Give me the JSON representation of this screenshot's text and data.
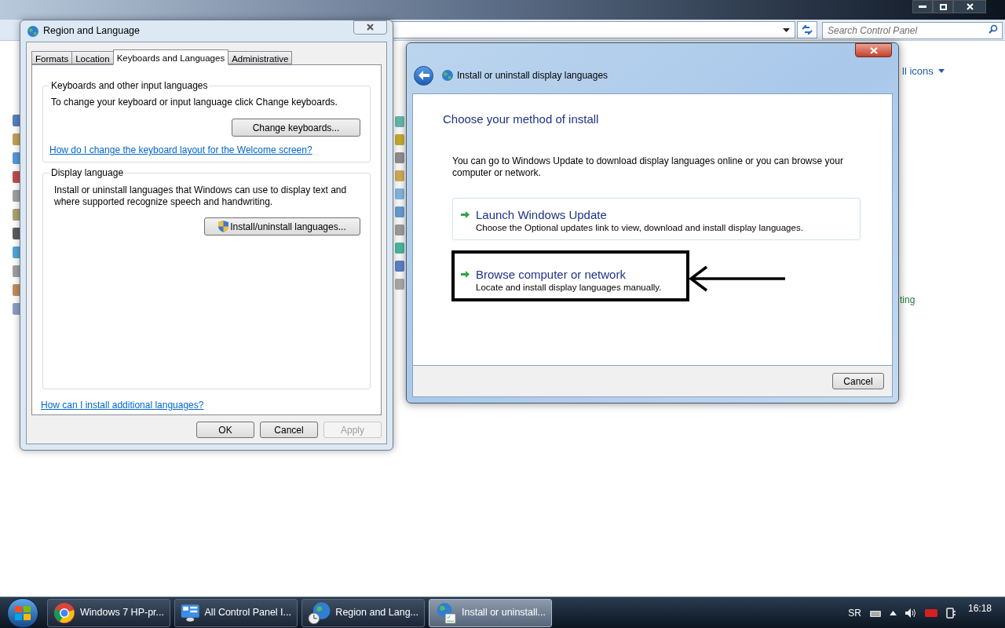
{
  "control_panel": {
    "search": {
      "placeholder": "Search Control Panel"
    },
    "view_by": "ll icons",
    "item_fragment": "ting"
  },
  "region_dialog": {
    "title": "Region and Language",
    "tabs": [
      {
        "label": "Formats",
        "selected": false
      },
      {
        "label": "Location",
        "selected": false
      },
      {
        "label": "Keyboards and Languages",
        "selected": true
      },
      {
        "label": "Administrative",
        "selected": false
      }
    ],
    "keyboards_group": {
      "legend": "Keyboards and other input languages",
      "text": "To change your keyboard or input language click Change keyboards.",
      "button": "Change keyboards...",
      "link": "How do I change the keyboard layout for the Welcome screen?"
    },
    "display_group": {
      "legend": "Display language",
      "text": "Install or uninstall languages that Windows can use to display text and where supported recognize speech and handwriting.",
      "button": "Install/uninstall languages..."
    },
    "link": "How can I install additional languages?",
    "buttons": [
      {
        "label": "OK",
        "disabled": false
      },
      {
        "label": "Cancel",
        "disabled": false
      },
      {
        "label": "Apply",
        "disabled": true
      }
    ]
  },
  "install_dialog": {
    "title": "Install or uninstall display languages",
    "heading": "Choose your method of install",
    "intro": "You can go to Windows Update to download display languages online or you can browse your computer or network.",
    "options": [
      {
        "title": "Launch Windows Update",
        "description": "Choose the Optional updates link to view, download and install display languages.",
        "focused": true,
        "highlighted": false
      },
      {
        "title": "Browse computer or network",
        "description": "Locate and install display languages manually.",
        "focused": false,
        "highlighted": true
      }
    ],
    "buttons": [
      "Cancel"
    ]
  },
  "taskbar": {
    "buttons": [
      {
        "label": "Windows 7 HP-pr...",
        "kind": "browser",
        "selected": false
      },
      {
        "label": "All Control Panel I...",
        "kind": "control-panel",
        "selected": false
      },
      {
        "label": "Region and Lang...",
        "kind": "region",
        "selected": false
      },
      {
        "label": "Install or uninstall...",
        "kind": "install",
        "selected": true
      }
    ],
    "tray": {
      "language": "SR",
      "time": "16:18"
    }
  }
}
